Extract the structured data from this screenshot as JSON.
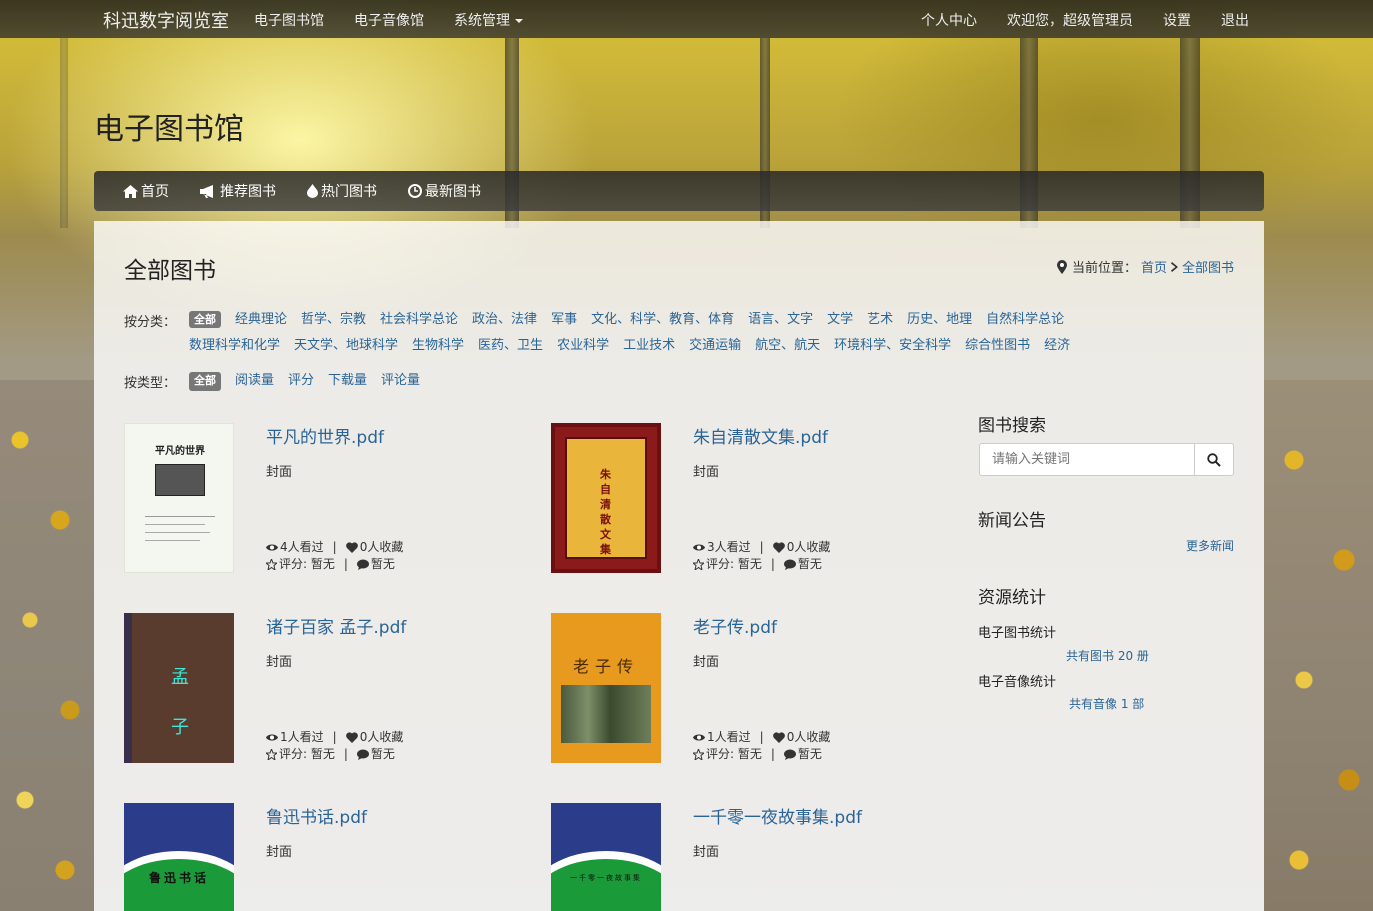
{
  "navbar": {
    "brand": "科迅数字阅览室",
    "left": [
      "电子图书馆",
      "电子音像馆",
      "系统管理"
    ],
    "right": [
      "个人中心",
      "欢迎您，超级管理员",
      "设置",
      "退出"
    ]
  },
  "page_title": "电子图书馆",
  "subnav": [
    {
      "label": "首页",
      "icon": "home-icon"
    },
    {
      "label": "推荐图书",
      "icon": "bullhorn-icon"
    },
    {
      "label": "热门图书",
      "icon": "fire-icon"
    },
    {
      "label": "最新图书",
      "icon": "clock-icon"
    }
  ],
  "panel": {
    "title": "全部图书",
    "breadcrumb_prefix": "当前位置：",
    "breadcrumb": [
      "首页",
      "全部图书"
    ]
  },
  "filters": {
    "category_label": "按分类：",
    "type_label": "按类型：",
    "all_badge": "全部",
    "categories": [
      "经典理论",
      "哲学、宗教",
      "社会科学总论",
      "政治、法律",
      "军事",
      "文化、科学、教育、体育",
      "语言、文字",
      "文学",
      "艺术",
      "历史、地理",
      "自然科学总论",
      "数理科学和化学",
      "天文学、地球科学",
      "生物科学",
      "医药、卫生",
      "农业科学",
      "工业技术",
      "交通运输",
      "航空、航天",
      "环境科学、安全科学",
      "综合性图书",
      "经济"
    ],
    "types": [
      "阅读量",
      "评分",
      "下载量",
      "评论量"
    ]
  },
  "books": [
    {
      "title": "平凡的世界.pdf",
      "cover_label": "封面",
      "viewed": "4人看过",
      "fav": "0人收藏",
      "rating": "评分: 暂无",
      "comments": "暂无",
      "cover_text": "平凡的世界"
    },
    {
      "title": "朱自清散文集.pdf",
      "cover_label": "封面",
      "viewed": "3人看过",
      "fav": "0人收藏",
      "rating": "评分: 暂无",
      "comments": "暂无",
      "cover_text": "朱自清散文集"
    },
    {
      "title": "诸子百家 孟子.pdf",
      "cover_label": "封面",
      "viewed": "1人看过",
      "fav": "0人收藏",
      "rating": "评分: 暂无",
      "comments": "暂无",
      "cover_text": "孟子"
    },
    {
      "title": "老子传.pdf",
      "cover_label": "封面",
      "viewed": "1人看过",
      "fav": "0人收藏",
      "rating": "评分: 暂无",
      "comments": "暂无",
      "cover_text": "老子传"
    },
    {
      "title": "鲁迅书话.pdf",
      "cover_label": "封面",
      "cover_text": "鲁迅书话"
    },
    {
      "title": "一千零一夜故事集.pdf",
      "cover_label": "封面",
      "cover_text": "一千零一夜故事集"
    }
  ],
  "sidebar": {
    "search_title": "图书搜索",
    "search_placeholder": "请输入关键词",
    "news_title": "新闻公告",
    "more_news": "更多新闻",
    "stats_title": "资源统计",
    "ebook_label": "电子图书统计",
    "ebook_count": "共有图书 20 册",
    "media_label": "电子音像统计",
    "media_count": "共有音像 1 部"
  },
  "colors": {
    "link": "#2a6496",
    "navbar": "#2b2b2b",
    "badge": "#777777"
  }
}
